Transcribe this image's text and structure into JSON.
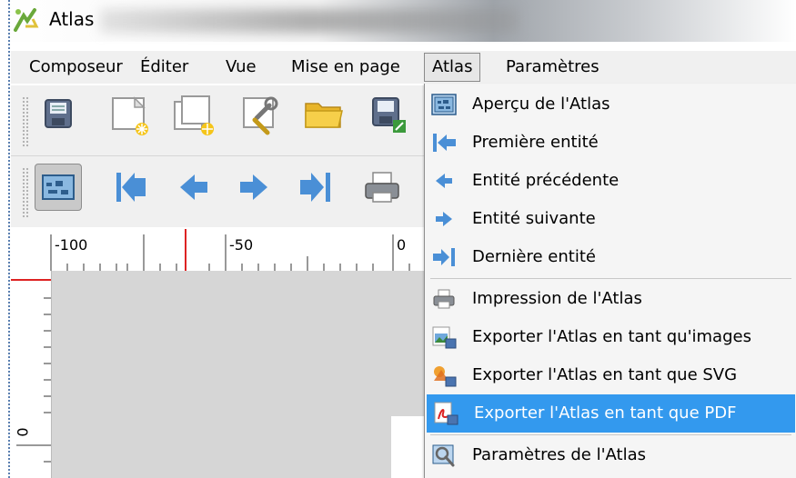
{
  "window": {
    "title": "Atlas"
  },
  "menubar": {
    "items": [
      "Composeur",
      "Éditer",
      "Vue",
      "Mise en page",
      "Atlas",
      "Paramètres"
    ],
    "active": "Atlas"
  },
  "toolbar1": {
    "icons": [
      "save-icon",
      "new-composer-icon",
      "duplicate-composer-icon",
      "composer-manager-icon",
      "open-folder-icon",
      "save-as-template-icon"
    ]
  },
  "toolbar2": {
    "icons": [
      "atlas-preview-icon",
      "first-feature-icon",
      "previous-feature-icon",
      "next-feature-icon",
      "last-feature-icon",
      "print-icon"
    ]
  },
  "ruler": {
    "labels": [
      "-100",
      "-50",
      "0"
    ],
    "left_label": "0"
  },
  "atlas_menu": {
    "items": [
      {
        "label": "Aperçu de l'Atlas",
        "icon": "atlas-preview-icon"
      },
      {
        "label": "Première entité",
        "icon": "first-feature-icon"
      },
      {
        "label": "Entité précédente",
        "icon": "previous-feature-icon"
      },
      {
        "label": "Entité suivante",
        "icon": "next-feature-icon"
      },
      {
        "label": "Dernière entité",
        "icon": "last-feature-icon"
      },
      {
        "label": "Impression de l'Atlas",
        "icon": "print-icon"
      },
      {
        "label": "Exporter l'Atlas en tant qu'images",
        "icon": "export-image-icon"
      },
      {
        "label": "Exporter l'Atlas en tant que SVG",
        "icon": "export-svg-icon"
      },
      {
        "label": "Exporter l'Atlas en tant que PDF",
        "icon": "export-pdf-icon"
      },
      {
        "label": "Paramètres de l'Atlas",
        "icon": "atlas-settings-icon"
      }
    ],
    "highlighted": "Exporter l'Atlas en tant que PDF"
  },
  "colors": {
    "highlight": "#3399ee",
    "arrow": "#4a8fd6",
    "menubar": "#f0f0f0"
  }
}
